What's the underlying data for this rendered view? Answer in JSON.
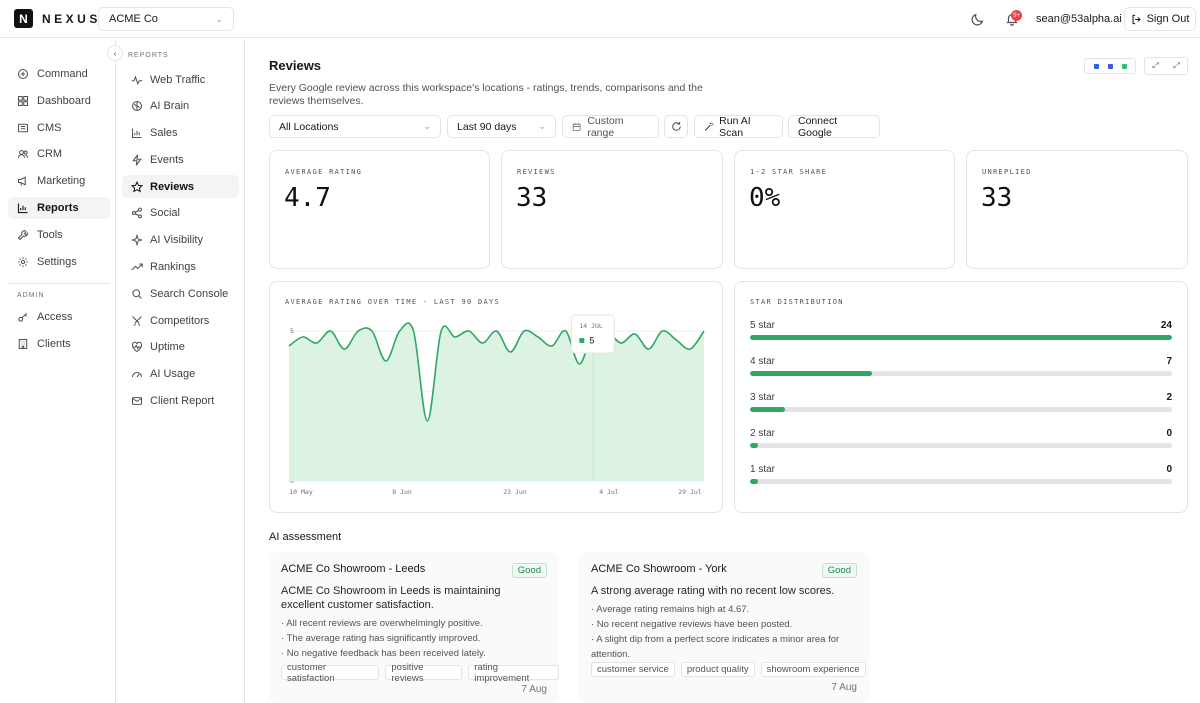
{
  "app": {
    "logo_letter": "N",
    "name": "NEXUS"
  },
  "workspace": {
    "selected": "ACME Co"
  },
  "topbar": {
    "notifications": "9+",
    "user_email": "sean@53alpha.ai",
    "sign_out": "Sign Out"
  },
  "nav": {
    "items": [
      "Command",
      "Dashboard",
      "CMS",
      "CRM",
      "Marketing",
      "Reports",
      "Tools",
      "Settings"
    ],
    "admin_label": "ADMIN",
    "admin_items": [
      "Access",
      "Clients"
    ],
    "active": "Reports"
  },
  "subnav": {
    "label": "REPORTS",
    "items": [
      "Web Traffic",
      "AI Brain",
      "Sales",
      "Events",
      "Reviews",
      "Social",
      "AI Visibility",
      "Rankings",
      "Search Console",
      "Competitors",
      "Uptime",
      "AI Usage",
      "Client Report"
    ],
    "active": "Reviews"
  },
  "page": {
    "title": "Reviews",
    "description": "Every Google review across this workspace's locations - ratings, trends, comparisons and the reviews themselves."
  },
  "filters": {
    "location": "All Locations",
    "range": "Last 90 days",
    "custom": "Custom range",
    "run_scan": "Run AI Scan",
    "connect": "Connect Google"
  },
  "stats": [
    {
      "label": "AVERAGE RATING",
      "value": "4.7"
    },
    {
      "label": "REVIEWS",
      "value": "33"
    },
    {
      "label": "1-2 STAR SHARE",
      "value": "0%"
    },
    {
      "label": "UNREPLIED",
      "value": "33"
    }
  ],
  "chart_data": {
    "type": "area",
    "title": "AVERAGE RATING OVER TIME · LAST 90 DAYS",
    "x_ticks": [
      "10 May",
      "8 Jun",
      "23 Jun",
      "4 Jul",
      "29 Jul"
    ],
    "y_ticks": [
      "5",
      "3",
      "0"
    ],
    "ylim": [
      0,
      5.5
    ],
    "values": [
      4.5,
      4.8,
      4.6,
      5,
      4.4,
      5,
      5,
      4,
      5,
      5,
      2,
      5,
      4.8,
      5,
      4.6,
      5,
      4.3,
      5,
      4.8,
      4.5,
      5,
      3.9,
      5,
      5,
      4.6,
      4.9,
      4.4,
      5,
      4.7,
      4.4,
      5
    ],
    "tooltip": {
      "label": "14 JUL",
      "value": "5"
    },
    "tooltip_index": 22,
    "grid": true,
    "color": "#2fa866"
  },
  "distribution": {
    "title": "STAR DISTRIBUTION",
    "rows": [
      {
        "label": "5 star",
        "count": "24",
        "fraction": 1.0
      },
      {
        "label": "4 star",
        "count": "7",
        "fraction": 0.29
      },
      {
        "label": "3 star",
        "count": "2",
        "fraction": 0.083
      },
      {
        "label": "2 star",
        "count": "0",
        "fraction": 0.02
      },
      {
        "label": "1 star",
        "count": "0",
        "fraction": 0.02
      }
    ]
  },
  "ai": {
    "title": "AI assessment",
    "cards": [
      {
        "name": "ACME Co Showroom - Leeds",
        "badge": "Good",
        "summary": "ACME Co Showroom in Leeds is maintaining excellent customer satisfaction.",
        "bullets": [
          "· All recent reviews are overwhelmingly positive.",
          "· The average rating has significantly improved.",
          "· No negative feedback has been received lately."
        ],
        "tags": [
          "customer satisfaction",
          "positive reviews",
          "rating improvement"
        ],
        "date": "7 Aug"
      },
      {
        "name": "ACME Co Showroom - York",
        "badge": "Good",
        "summary": "A strong average rating with no recent low scores.",
        "bullets": [
          "· Average rating remains high at 4.67.",
          "· No recent negative reviews have been posted.",
          "· A slight dip from a perfect score indicates a minor area for attention."
        ],
        "tags": [
          "customer service",
          "product quality",
          "showroom experience"
        ],
        "date": "7 Aug"
      }
    ]
  },
  "colors": {
    "accent": "#2fa866",
    "badge_red": "#ef4444",
    "toggle_blue": "#2563eb",
    "toggle_green": "#22c55e"
  }
}
